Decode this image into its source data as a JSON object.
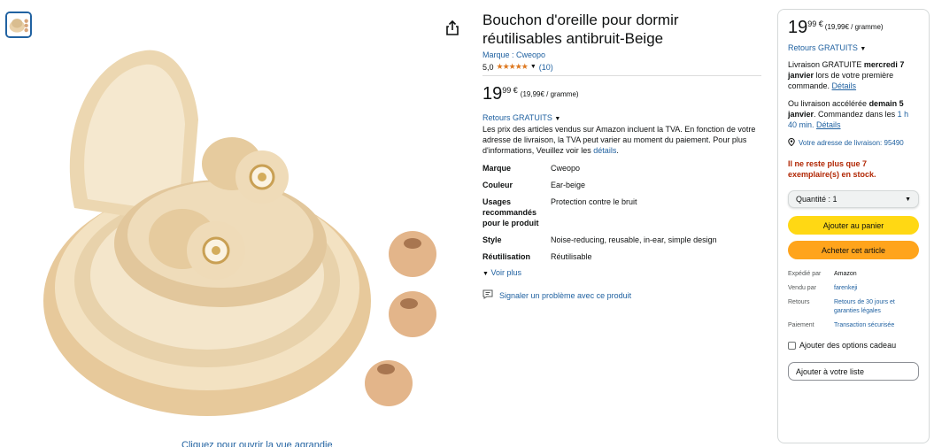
{
  "product": {
    "title": "Bouchon d'oreille pour dormir réutilisables antibruit-Beige",
    "brand_label": "Marque : Cweopo",
    "rating_value": "5,0",
    "rating_stars": "★★★★★",
    "rating_count": "(10)",
    "price_int": "19",
    "price_frac": "99 €",
    "price_per": "(19,99€ / gramme)",
    "returns": "Retours GRATUITS",
    "tva_text": "Les prix des articles vendus sur Amazon incluent la TVA. En fonction de votre adresse de livraison, la TVA peut varier au moment du paiement. Pour plus d'informations, Veuillez voir les",
    "tva_link": "détails",
    "specs": [
      {
        "key": "Marque",
        "value": "Cweopo"
      },
      {
        "key": "Couleur",
        "value": "Ear-beige"
      },
      {
        "key": "Usages recommandés pour le produit",
        "value": "Protection contre le bruit"
      },
      {
        "key": "Style",
        "value": "Noise-reducing, reusable, in-ear, simple design"
      },
      {
        "key": "Réutilisation",
        "value": "Réutilisable"
      }
    ],
    "see_more": "Voir plus",
    "report": "Signaler un problème avec ce produit",
    "zoom_hint": "Cliquez pour ouvrir la vue agrandie"
  },
  "buybox": {
    "price_int": "19",
    "price_frac": "99 €",
    "price_per": "(19,99€ / gramme)",
    "returns": "Retours GRATUITS",
    "delivery_pre": "Livraison GRATUITE",
    "delivery_date": "mercredi 7 janvier",
    "delivery_post": "lors de votre première commande.",
    "details_link": "Détails",
    "fast_pre": "Ou livraison accélérée",
    "fast_date": "demain 5 janvier",
    "fast_mid": ". Commandez dans les",
    "fast_time": "1 h 40 min.",
    "location": "Votre adresse de livraison:  95490",
    "stock": "Il ne reste plus que 7 exemplaire(s) en stock.",
    "quantity": "Quantité : 1",
    "add_to_cart": "Ajouter au panier",
    "buy_now": "Acheter cet article",
    "info": [
      {
        "key": "Expédié par",
        "value": "Amazon",
        "link": false
      },
      {
        "key": "Vendu par",
        "value": "farenkeji",
        "link": true
      },
      {
        "key": "Retours",
        "value": "Retours de 30 jours et garanties légales",
        "link": true
      },
      {
        "key": "Paiement",
        "value": "Transaction sécurisée",
        "link": true
      }
    ],
    "gift": "Ajouter des options cadeau",
    "add_list": "Ajouter à votre liste"
  },
  "colors": {
    "link": "#2162a1",
    "star": "#de7921",
    "cart_button": "#ffd814",
    "buy_button": "#ffa41c",
    "stock": "#b12704"
  }
}
